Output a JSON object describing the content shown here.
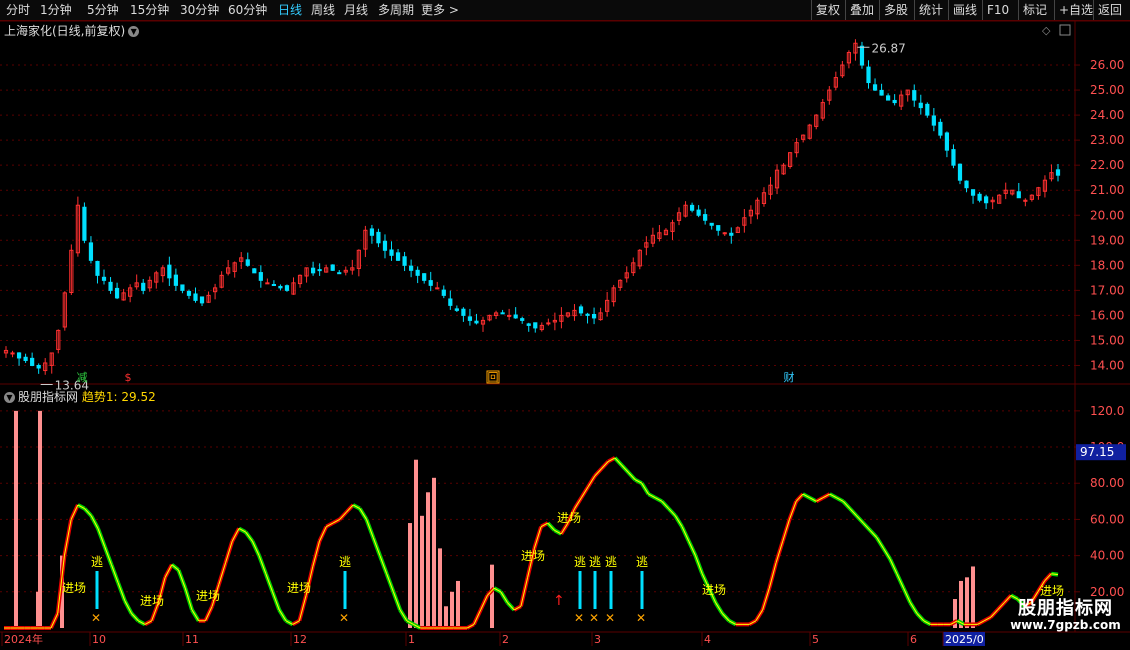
{
  "toolbar": {
    "periods": [
      "分时",
      "1分钟",
      "5分钟",
      "15分钟",
      "30分钟",
      "60分钟",
      "日线",
      "周线",
      "月线",
      "多周期",
      "更多 >"
    ],
    "active_period": "日线",
    "right_buttons": [
      "复权",
      "叠加",
      "多股",
      "统计",
      "画线",
      "F10",
      "标记",
      "+自选",
      "返回"
    ]
  },
  "main_panel": {
    "title": "上海家化(日线,前复权)",
    "high_label": "26.87",
    "low_label": "13.64",
    "price_axis": [
      "26.00",
      "25.00",
      "24.00",
      "23.00",
      "22.00",
      "21.00",
      "20.00",
      "19.00",
      "18.00",
      "17.00",
      "16.00",
      "15.00",
      "14.00"
    ],
    "markers": [
      {
        "text": "减",
        "color": "#2ecc40"
      },
      {
        "text": "$",
        "color": "#ff3030"
      },
      {
        "text": "回",
        "color": "#ffa500"
      },
      {
        "text": "财",
        "color": "#3cf"
      }
    ]
  },
  "indicator_panel": {
    "title": "股朋指标网",
    "series_label": "趋势1:",
    "series_value": "29.52",
    "axis": [
      "120.0",
      "100.0",
      "80.00",
      "60.00",
      "40.00",
      "20.00"
    ],
    "current_value_box": "97.15",
    "signals": {
      "entry_label": "进场",
      "escape_label": "逃"
    }
  },
  "time_axis": {
    "labels": [
      "2024年",
      "10",
      "11",
      "12",
      "1",
      "2",
      "3",
      "4",
      "5",
      "6",
      "2025/0"
    ]
  },
  "watermark": {
    "line1": "股朋指标网",
    "line2": "www.7gpzb.com"
  },
  "colors": {
    "up": "#ff3030",
    "down": "#00e0ff",
    "trend_up": "#e00000",
    "trend_down": "#00d000",
    "trend_line": "#ffff00",
    "bar": "#ff9090",
    "grid": "#5a0000",
    "axis_text": "#ff5050"
  },
  "chart_data": [
    {
      "type": "candlestick",
      "title": "上海家化(日线,前复权)",
      "y_axis_ticks": [
        14,
        15,
        16,
        17,
        18,
        19,
        20,
        21,
        22,
        23,
        24,
        25,
        26
      ],
      "ylim": [
        13.3,
        27.0
      ],
      "annotations": {
        "high": 26.87,
        "low": 13.64
      },
      "close_path_by_month": [
        {
          "month": "2024-09",
          "closes": [
            14.6,
            14.5,
            14.3,
            14.2,
            14.0,
            13.9,
            14.1,
            14.5,
            15.4,
            16.9,
            18.6,
            20.4,
            19.0,
            18.2,
            17.6
          ]
        },
        {
          "month": "2024-10",
          "closes": [
            17.4,
            17.0,
            16.7,
            16.9,
            17.1,
            17.3,
            17.0,
            17.4,
            17.7,
            17.9,
            17.5,
            17.2,
            17.0,
            16.8,
            16.6,
            16.5,
            16.8,
            17.1
          ]
        },
        {
          "month": "2024-11",
          "closes": [
            17.6,
            17.9,
            18.1,
            18.3,
            18.0,
            17.7,
            17.4,
            17.3,
            17.2,
            17.1,
            17.0,
            17.3,
            17.6,
            17.9,
            17.7,
            17.8,
            17.9,
            17.8,
            17.7,
            17.8,
            17.9
          ]
        },
        {
          "month": "2024-12",
          "closes": [
            18.6,
            19.4,
            19.2,
            18.9,
            18.6,
            18.4,
            18.2,
            18.0,
            17.8,
            17.6,
            17.4,
            17.2,
            17.1,
            16.8,
            16.4,
            16.2,
            16.0,
            15.8,
            15.7,
            15.8,
            16.0,
            16.1
          ]
        },
        {
          "month": "2025-01",
          "closes": [
            16.1,
            16.0,
            15.9,
            15.8,
            15.6,
            15.5,
            15.6,
            15.7,
            15.8,
            16.0,
            16.1,
            16.2,
            16.1,
            16.0,
            15.9
          ]
        },
        {
          "month": "2025-02",
          "closes": [
            16.1,
            16.6,
            17.1,
            17.4,
            17.7,
            18.1,
            18.6,
            18.9,
            19.2,
            19.3,
            19.4,
            19.7,
            20.1,
            20.4,
            20.2,
            20.0,
            19.8,
            19.6
          ]
        },
        {
          "month": "2025-03",
          "closes": [
            19.4,
            19.3,
            19.2,
            19.5,
            19.9,
            20.2,
            20.6,
            20.9,
            21.2,
            21.8,
            22.0,
            22.5,
            22.9,
            23.2,
            23.6,
            24.0,
            24.5,
            25.0,
            25.5,
            26.0,
            26.5,
            26.87,
            26.0,
            25.3
          ]
        },
        {
          "month": "2025-04",
          "closes": [
            25.0,
            24.8,
            24.6,
            24.5,
            24.8,
            25.0,
            24.6,
            24.3,
            24.0,
            23.6,
            23.2,
            22.6,
            22.0,
            21.4,
            21.1,
            20.8,
            20.6,
            20.5
          ]
        },
        {
          "month": "2025-05",
          "closes": [
            20.6,
            20.8,
            21.0,
            21.0,
            20.7,
            20.6,
            20.8,
            21.1,
            21.4,
            21.7,
            21.6
          ]
        }
      ]
    },
    {
      "type": "line",
      "title": "股朋指标网",
      "series": [
        {
          "name": "趋势1",
          "last_value": 29.52
        }
      ],
      "y_axis_ticks": [
        20,
        40,
        60,
        80,
        100,
        120
      ],
      "ylim": [
        0,
        126
      ],
      "current_value_box": 97.15,
      "trend1_by_month": [
        {
          "month": "2024-09",
          "values": [
            0,
            0,
            0,
            0,
            0,
            0,
            0,
            0,
            8,
            40,
            60,
            68,
            66,
            62
          ]
        },
        {
          "month": "2024-10",
          "values": [
            55,
            45,
            35,
            25,
            15,
            8,
            4,
            2,
            4,
            14,
            28,
            35,
            32,
            22,
            10,
            4,
            4,
            12,
            24,
            36,
            48,
            55,
            53,
            48
          ]
        },
        {
          "month": "2024-11",
          "values": [
            40,
            30,
            20,
            10,
            4,
            2,
            4,
            18,
            34,
            48,
            56,
            58,
            60,
            64,
            68,
            66,
            60,
            50,
            40,
            30,
            20,
            10,
            4,
            2
          ]
        },
        {
          "month": "2024-12",
          "values": [
            0,
            0,
            0,
            0,
            0,
            0,
            0,
            0,
            2,
            10,
            18,
            22,
            20,
            14,
            10,
            12,
            28,
            44,
            56,
            58,
            54,
            52,
            58,
            66,
            72,
            78,
            84,
            88,
            92,
            94,
            90,
            86,
            82,
            80,
            74,
            72,
            70,
            66,
            62
          ]
        },
        {
          "month": "2025-01",
          "values": [
            56,
            48,
            40,
            30,
            22,
            14,
            8,
            4,
            2,
            2,
            2,
            4,
            10,
            22,
            36,
            48,
            60,
            70,
            74,
            72,
            70,
            72,
            74,
            72,
            70,
            66,
            62,
            58,
            54,
            50,
            44,
            38,
            30,
            22,
            14,
            8,
            4,
            2
          ]
        },
        {
          "month": "2025-02",
          "values": [
            2,
            2,
            2,
            4,
            2,
            2,
            2,
            4,
            6,
            10,
            14,
            18,
            16,
            12,
            14,
            20,
            26,
            30,
            29.52
          ]
        }
      ],
      "histogram_bars": [
        120,
        120,
        0,
        0,
        0,
        0,
        0,
        0,
        20,
        40,
        58,
        93,
        62,
        75,
        83,
        0,
        0,
        44,
        0,
        0,
        0,
        0,
        0,
        0,
        0,
        0,
        0,
        0,
        0,
        0,
        0,
        0,
        12,
        20,
        26,
        35,
        0,
        16,
        26,
        28,
        34
      ],
      "signals": {
        "entry": [
          "进场",
          "进场",
          "进场",
          "进场",
          "进场",
          "进场",
          "进场",
          "进场"
        ],
        "escape": [
          "逃",
          "逃",
          "逃",
          "逃",
          "逃",
          "逃"
        ]
      }
    }
  ]
}
